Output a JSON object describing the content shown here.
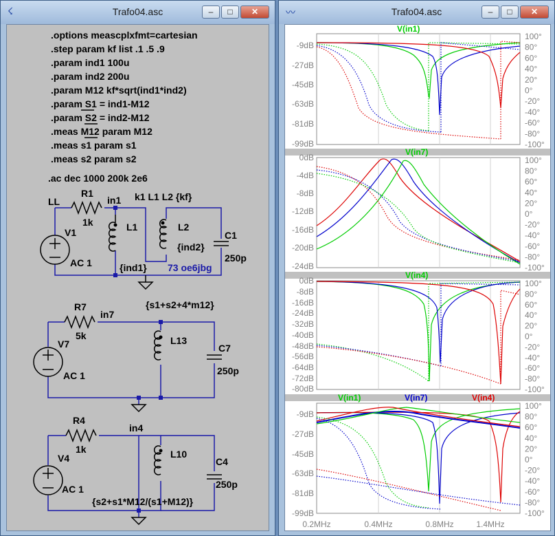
{
  "left_window": {
    "title": "Trafo04.asc",
    "buttons": {
      "minimize": "–",
      "maximize": "□",
      "close": "✕"
    },
    "directives": [
      ".options meascplxfmt=cartesian",
      ".step param kf list .1 .5  .9",
      ".param ind1 100u",
      ".param ind2 200u",
      ".param M12 kf*sqrt(ind1*ind2)",
      ".param S1 = ind1-M12",
      ".param S2 = ind2-M12",
      ".meas M12 param M12",
      ".meas s1 param s1",
      ".meas s2 param s2"
    ],
    "ac_directive": ".ac dec 1000 200k 2e6",
    "circuit1": {
      "ll": "LL",
      "r1": "R1",
      "r1_val": "1k",
      "in1": "in1",
      "k": "k1 L1 L2 {kf}",
      "v1": "V1",
      "ac1": "AC 1",
      "l1": "L1",
      "l2": "L2",
      "ind2": "{ind2}",
      "c1": "C1",
      "c1_val": "250p",
      "ind1": "{ind1}",
      "credit": "73 oe6jbg"
    },
    "circuit2": {
      "r7": "R7",
      "r7_val": "5k",
      "in7": "in7",
      "expr": "{s1+s2+4*m12}",
      "v7": "V7",
      "ac": "AC 1",
      "l13": "L13",
      "c7": "C7",
      "c7_val": "250p"
    },
    "circuit3": {
      "r4": "R4",
      "r4_val": "1k",
      "in4": "in4",
      "v4": "V4",
      "ac": "AC 1",
      "l10": "L10",
      "c4": "C4",
      "c4_val": "250p",
      "expr": "{s2+s1*M12/(s1+M12)}"
    }
  },
  "right_window": {
    "title": "Trafo04.asc",
    "buttons": {
      "minimize": "–",
      "maximize": "□",
      "close": "✕"
    },
    "pane1": {
      "trace": "V(in1)",
      "left_ticks": [
        "-9dB",
        "-27dB",
        "-45dB",
        "-63dB",
        "-81dB",
        "-99dB"
      ],
      "right_ticks": [
        "100°",
        "80°",
        "60°",
        "40°",
        "20°",
        "0°",
        "-20°",
        "-40°",
        "-60°",
        "-80°",
        "-100°"
      ]
    },
    "pane2": {
      "trace": "V(in7)",
      "left_ticks": [
        "0dB",
        "-4dB",
        "-8dB",
        "-12dB",
        "-16dB",
        "-20dB",
        "-24dB"
      ],
      "right_ticks": [
        "100°",
        "80°",
        "60°",
        "40°",
        "20°",
        "0°",
        "-20°",
        "-40°",
        "-60°",
        "-80°",
        "-100°"
      ]
    },
    "pane3": {
      "trace": "V(in4)",
      "left_ticks": [
        "0dB",
        "-8dB",
        "-16dB",
        "-24dB",
        "-32dB",
        "-40dB",
        "-48dB",
        "-56dB",
        "-64dB",
        "-72dB",
        "-80dB"
      ],
      "right_ticks": [
        "100°",
        "80°",
        "60°",
        "40°",
        "20°",
        "0°",
        "-20°",
        "-40°",
        "-60°",
        "-80°",
        "-100°"
      ]
    },
    "pane4": {
      "traces": [
        "V(in1)",
        "V(in7)",
        "V(in4)"
      ],
      "left_ticks": [
        "-9dB",
        "-27dB",
        "-45dB",
        "-63dB",
        "-81dB",
        "-99dB"
      ],
      "right_ticks": [
        "100°",
        "80°",
        "60°",
        "40°",
        "20°",
        "0°",
        "-20°",
        "-40°",
        "-60°",
        "-80°",
        "-100°"
      ]
    },
    "x_ticks": [
      "0.2MHz",
      "0.4MHz",
      "0.8MHz",
      "1.4MHz"
    ],
    "colors": {
      "green": "#00cc00",
      "blue": "#0000cc",
      "red": "#dd0000",
      "wire": "#1a1aa8"
    }
  }
}
